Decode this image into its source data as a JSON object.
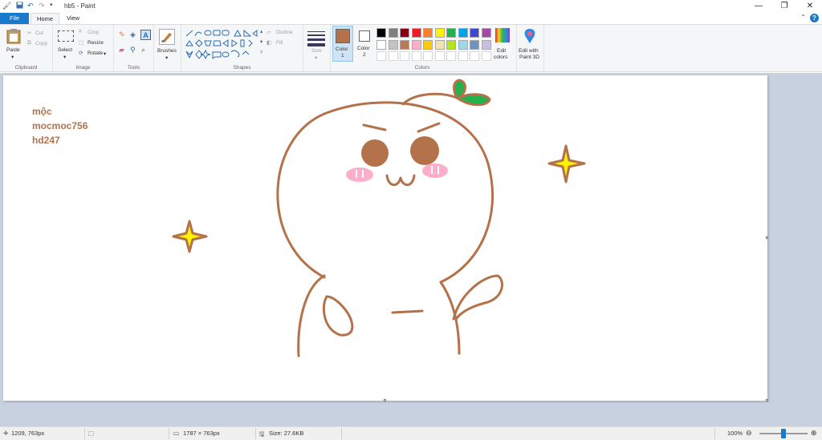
{
  "window": {
    "title": "hb5 - Paint",
    "controls": [
      "minimize",
      "maximize",
      "close"
    ]
  },
  "ribbon_tabs": {
    "file": "File",
    "home": "Home",
    "view": "View"
  },
  "clipboard": {
    "paste": "Paste",
    "cut": "Cut",
    "copy": "Copy",
    "label": "Clipboard"
  },
  "image": {
    "select": "Select",
    "crop": "Crop",
    "resize": "Resize",
    "rotate": "Rotate",
    "label": "Image"
  },
  "tools": {
    "label": "Tools"
  },
  "brushes": {
    "label": "Brushes"
  },
  "shapes": {
    "outline": "Outline",
    "fill": "Fill",
    "label": "Shapes"
  },
  "size": {
    "label": "Size"
  },
  "colors": {
    "color1_label": "Color",
    "color1_num": "1",
    "color2_label": "Color",
    "color2_num": "2",
    "edit_colors": "Edit",
    "edit_colors2": "colors",
    "edit_paint3d": "Edit with",
    "edit_paint3d2": "Paint 3D",
    "label": "Colors",
    "color1": "#b3724a",
    "color2": "#ffffff",
    "palette_row1": [
      "#000000",
      "#7f7f7f",
      "#880015",
      "#ed1c24",
      "#ff7f27",
      "#fff200",
      "#22b14c",
      "#00a2e8",
      "#3f48cc",
      "#a349a4"
    ],
    "palette_row2": [
      "#ffffff",
      "#c3c3c3",
      "#b97a57",
      "#ffaec9",
      "#ffc90e",
      "#efe4b0",
      "#b5e61d",
      "#99d9ea",
      "#7092be",
      "#c8bfe7"
    ]
  },
  "canvas": {
    "text_lines": [
      "mộc",
      "mocmoc756",
      "hd247"
    ],
    "stroke_color": "#b3724a",
    "sparkle_color": "#fff200",
    "leaf_color": "#22b14c",
    "blush_color": "#ffaec9"
  },
  "status": {
    "cursor": "1209, 763px",
    "dimensions": "1787 × 763px",
    "file_size": "Size: 27.6KB",
    "zoom": "100%",
    "zoom_fraction": 0.5
  }
}
